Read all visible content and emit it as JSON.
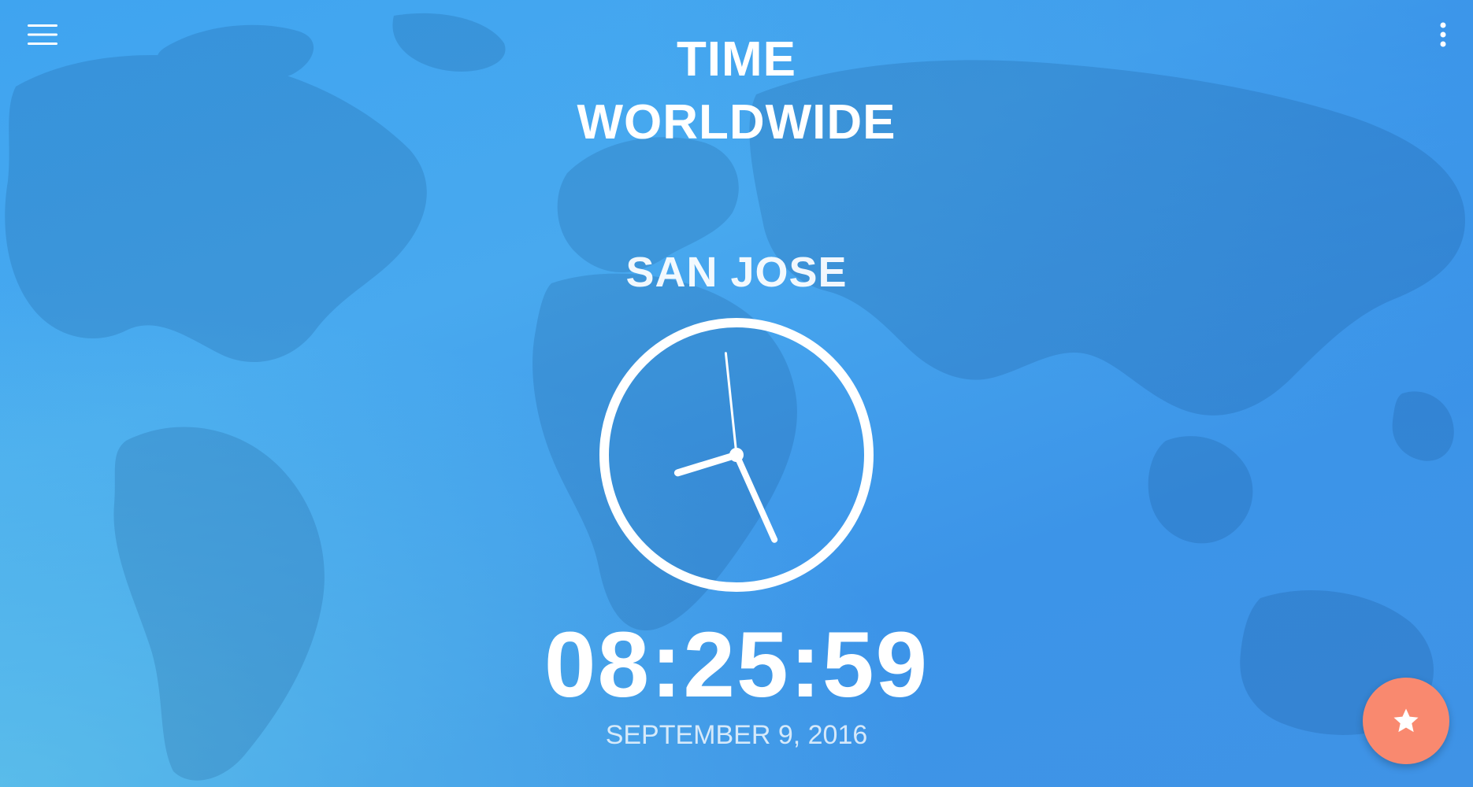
{
  "app": {
    "title_line1": "TIME",
    "title_line2": "WORLDWIDE"
  },
  "toolbar": {
    "menu_icon": "hamburger-menu-icon",
    "overflow_icon": "more-vertical-icon"
  },
  "clock": {
    "city": "SAN JOSE",
    "time": "08:25:59",
    "date": "SEPTEMBER 9, 2016",
    "hours": 8,
    "minutes": 25,
    "seconds": 59
  },
  "fab": {
    "icon": "star-icon"
  },
  "colors": {
    "background_start": "#3fa4f0",
    "background_end": "#3f93e6",
    "text": "#ffffff",
    "fab": "#f9896f"
  }
}
